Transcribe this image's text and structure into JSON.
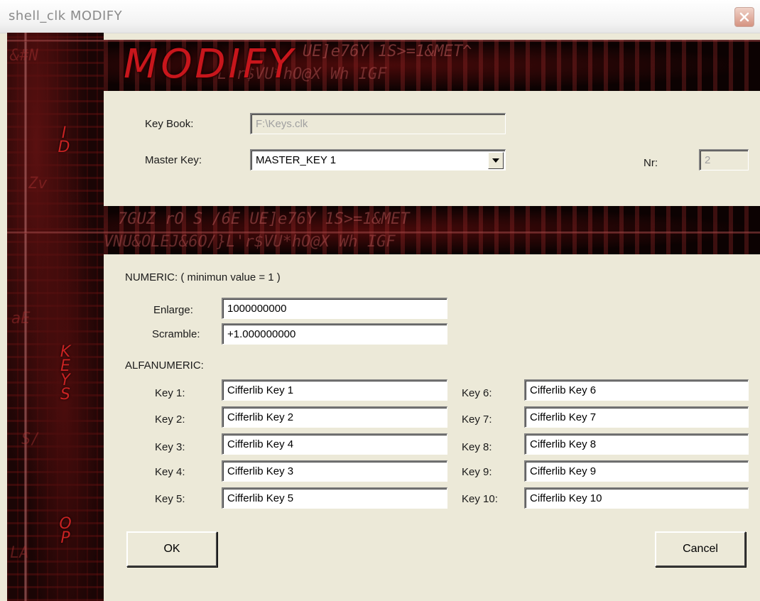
{
  "window": {
    "title": "shell_clk MODIFY"
  },
  "header": {
    "heading": "MODIFY",
    "background_text_1": "UE]e76Y 1S>=1&MET^",
    "background_text_2": "L'r$VU*hO@X Wh IGF",
    "background_text_3": "7GUZ rO S /6E UE]e76Y 1S>=1&MET",
    "background_text_4": "VNU&OLEJ&6O/}L'r$VU*hO@X Wh IGF"
  },
  "sidebar": {
    "section_id": [
      "I",
      "D"
    ],
    "section_keys": [
      "K",
      "E",
      "Y",
      "S"
    ],
    "section_op": [
      "O",
      "P"
    ]
  },
  "id_section": {
    "key_book_label": "Key Book:",
    "key_book_value": "F:\\Keys.clk",
    "master_key_label": "Master Key:",
    "master_key_value": "MASTER_KEY 1",
    "nr_label": "Nr:",
    "nr_value": "2"
  },
  "numeric": {
    "heading": "NUMERIC: ( minimun value = 1 )",
    "enlarge_label": "Enlarge:",
    "enlarge_value": "1000000000",
    "scramble_label": "Scramble:",
    "scramble_value": "+1.000000000"
  },
  "alfanumeric": {
    "heading": "ALFANUMERIC:",
    "keys": [
      {
        "label": "Key 1:",
        "value": "Cifferlib Key 1"
      },
      {
        "label": "Key 2:",
        "value": "Cifferlib Key 2"
      },
      {
        "label": "Key 3:",
        "value": "Cifferlib Key 4"
      },
      {
        "label": "Key 4:",
        "value": "Cifferlib Key 3"
      },
      {
        "label": "Key 5:",
        "value": "Cifferlib Key 5"
      },
      {
        "label": "Key 6:",
        "value": "Cifferlib Key 6"
      },
      {
        "label": "Key 7:",
        "value": "Cifferlib Key 7"
      },
      {
        "label": "Key 8:",
        "value": "Cifferlib Key 8"
      },
      {
        "label": "Key 9:",
        "value": "Cifferlib Key 9"
      },
      {
        "label": "Key 10:",
        "value": "Cifferlib Key 10"
      }
    ]
  },
  "buttons": {
    "ok_label": "OK",
    "cancel_label": "Cancel"
  },
  "colors": {
    "accent_red": "#c8161c",
    "dialog_bg": "#ece9d8",
    "dark_bg": "#0a0202"
  }
}
